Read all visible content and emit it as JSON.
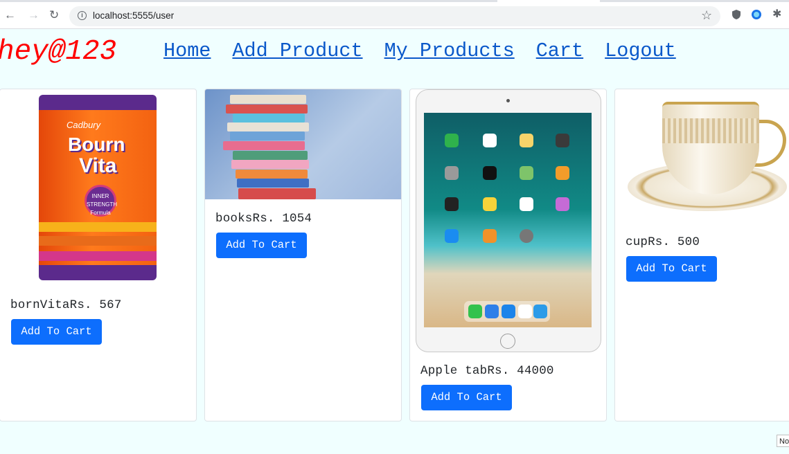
{
  "browser": {
    "url": "localhost:5555/user",
    "icons": [
      "back-arrow-icon",
      "forward-arrow-icon",
      "reload-icon",
      "info-icon",
      "star-icon",
      "shield-icon",
      "globe-icon",
      "puzzle-icon"
    ]
  },
  "navbar": {
    "brand": "hey@123",
    "links": [
      "Home",
      "Add Product",
      "My Products",
      "Cart",
      "Logout"
    ]
  },
  "products": [
    {
      "name": "bornVita",
      "price": "Rs. 567",
      "label": "bornVitaRs. 567",
      "button": "Add To Cart",
      "image": "bournvita-pack"
    },
    {
      "name": "books",
      "price": "Rs. 1054",
      "label": "booksRs. 1054",
      "button": "Add To Cart",
      "image": "book-stack"
    },
    {
      "name": "Apple tab",
      "price": "Rs. 44000",
      "label": "Apple tabRs. 44000",
      "button": "Add To Cart",
      "image": "ipad"
    },
    {
      "name": "cup",
      "price": "Rs. 500",
      "label": "cupRs. 500",
      "button": "Add To Cart",
      "image": "teacup"
    }
  ],
  "packaging_text": {
    "brand_small": "Cadbury",
    "brand_line1": "Bourn",
    "brand_line2": "Vita",
    "badge": "INNER STRENGTH Formula"
  },
  "status_tip": "No",
  "colors": {
    "page_bg": "#f0ffff",
    "brand": "#ff0000",
    "link": "#0a58ca",
    "button": "#0d6efd"
  }
}
